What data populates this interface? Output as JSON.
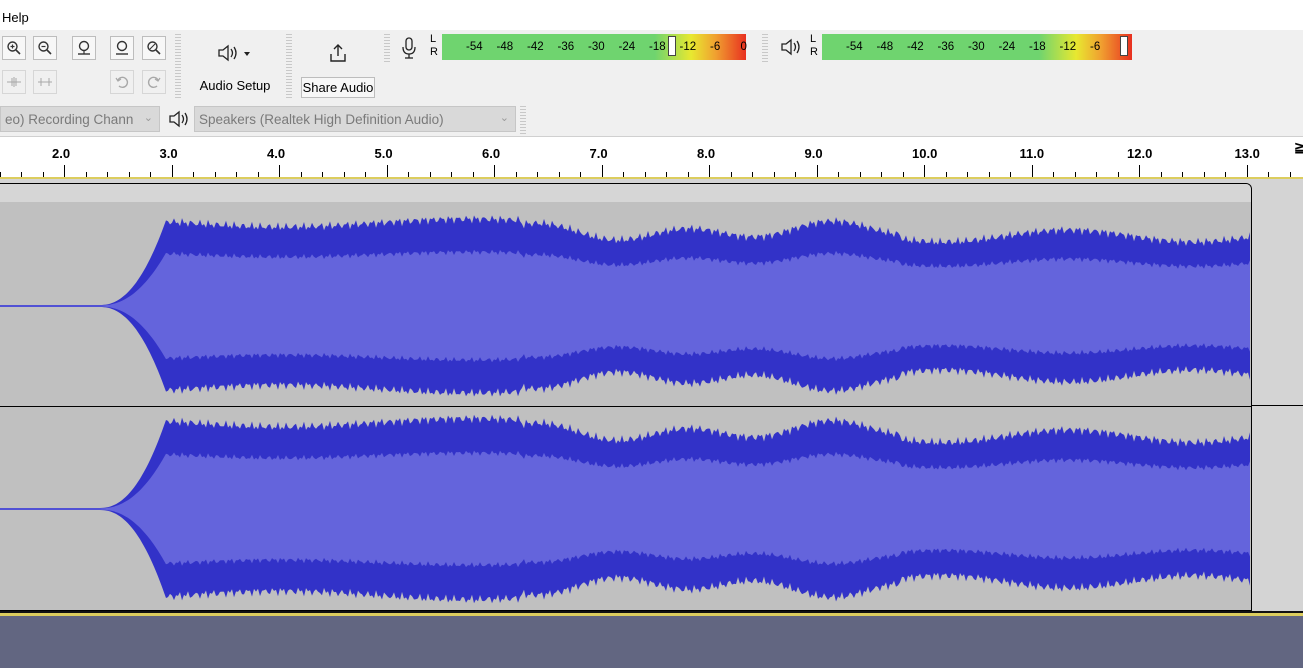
{
  "menu": {
    "help_label": "Help"
  },
  "toolbar": {
    "zoom_in_icon": "zoom-in-icon",
    "audio_setup_label": "Audio Setup",
    "share_audio_label": "Share Audio"
  },
  "record_meter": {
    "l_label": "L",
    "r_label": "R",
    "ticks": [
      "-54",
      "-48",
      "-42",
      "-36",
      "-30",
      "-24",
      "-18",
      "-12",
      "-6",
      "0"
    ]
  },
  "playback_meter": {
    "l_label": "L",
    "r_label": "R",
    "ticks": [
      "-54",
      "-48",
      "-42",
      "-36",
      "-30",
      "-24",
      "-18",
      "-12",
      "-6"
    ]
  },
  "devices": {
    "recording_channels": "eo) Recording Chann",
    "playback_device": "Speakers (Realtek High Definition Audio)"
  },
  "ruler": {
    "labels": [
      "2.0",
      "3.0",
      "4.0",
      "5.0",
      "6.0",
      "7.0",
      "8.0",
      "9.0",
      "10.0",
      "11.0",
      "12.0",
      "13.0"
    ],
    "trailing_mark": "≧"
  },
  "colors": {
    "waveform": "#3232c8",
    "waveform_rms": "#6464dc",
    "clip_background": "#c0c0c0",
    "selection_line": "#dccd5e",
    "bottom_area": "#626681"
  }
}
